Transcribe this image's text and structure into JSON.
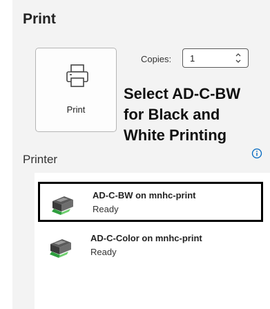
{
  "header": {
    "title": "Print"
  },
  "print_button": {
    "label": "Print",
    "icon": "printer-icon"
  },
  "copies": {
    "label": "Copies:",
    "value": "1"
  },
  "annotation": {
    "lines": [
      "Select AD-C-BW",
      "for Black and",
      "White Printing"
    ]
  },
  "printer_section": {
    "label": "Printer",
    "info_icon": "info-icon",
    "printers": [
      {
        "name": "AD-C-BW on mnhc-print",
        "status": "Ready",
        "selected": true,
        "icon": "network-printer-icon"
      },
      {
        "name": "AD-C-Color on mnhc-print",
        "status": "Ready",
        "selected": false,
        "icon": "network-printer-icon"
      }
    ]
  },
  "colors": {
    "background": "#f3f3f3",
    "list_background": "#ffffff",
    "selection_border": "#000000",
    "info_icon": "#0067c0"
  }
}
